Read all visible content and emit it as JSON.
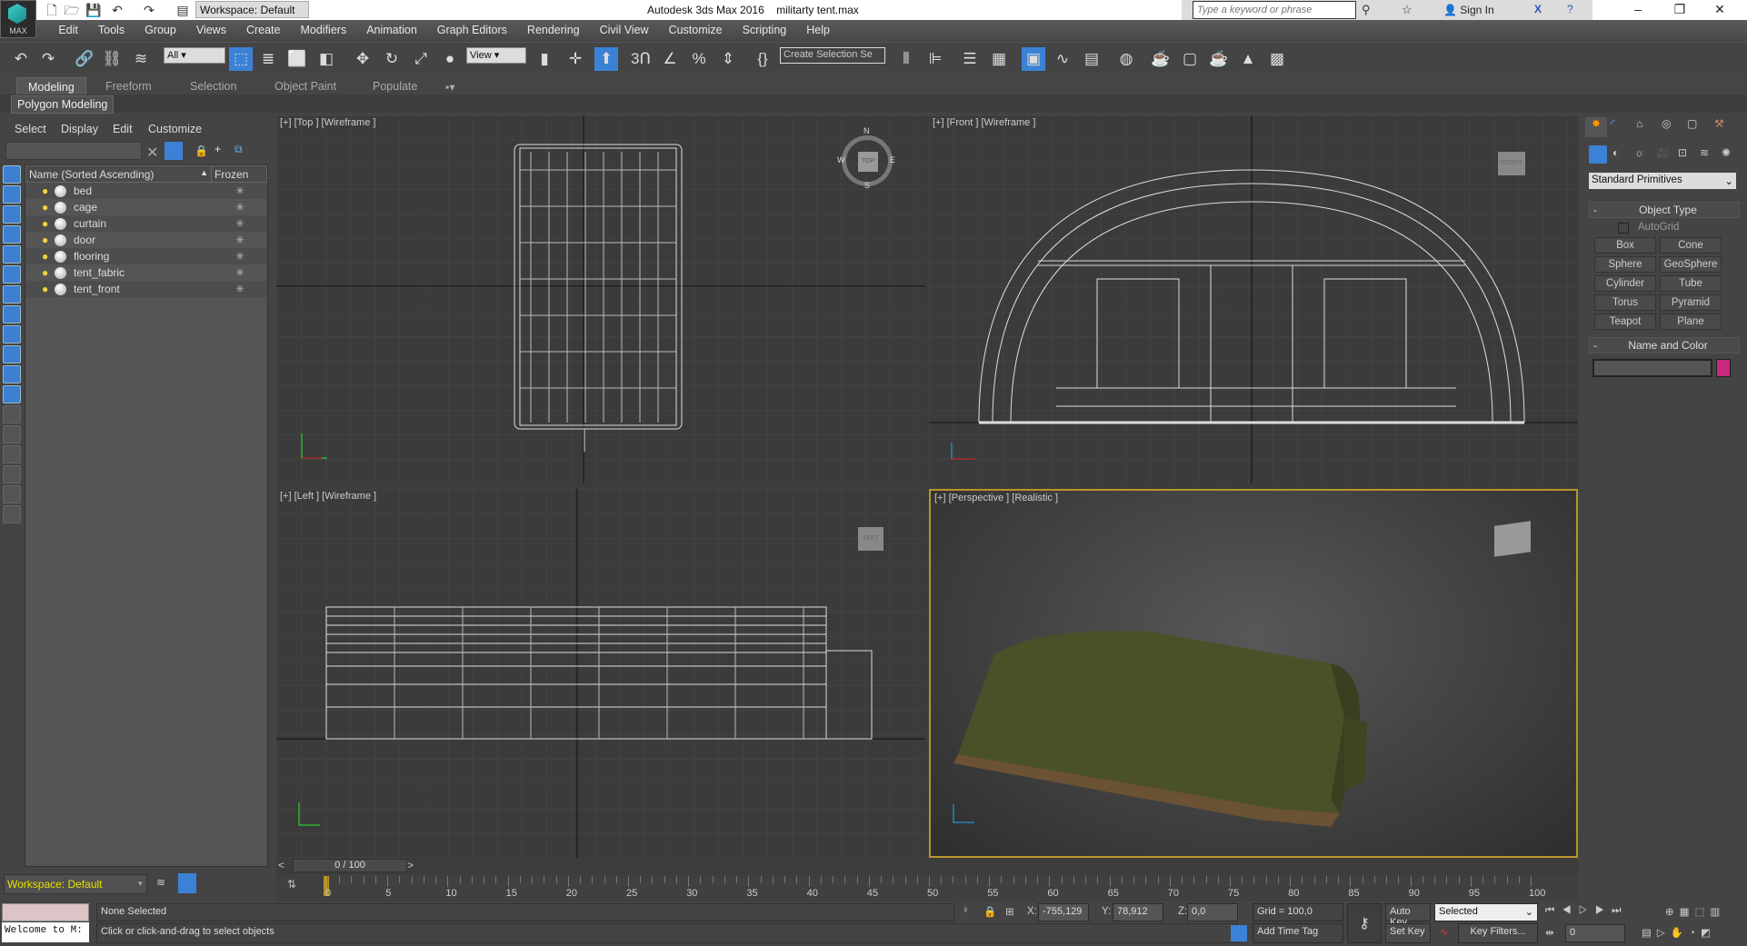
{
  "titlebar": {
    "workspace": "Workspace: Default",
    "app_title": "Autodesk 3ds Max 2016",
    "file_name": "militarty tent.max",
    "search_placeholder": "Type a keyword or phrase",
    "sign_in": "Sign In",
    "logo_text": "MAX"
  },
  "menu": [
    "Edit",
    "Tools",
    "Group",
    "Views",
    "Create",
    "Modifiers",
    "Animation",
    "Graph Editors",
    "Rendering",
    "Civil View",
    "Customize",
    "Scripting",
    "Help"
  ],
  "toolbar": {
    "selection_filter": "All",
    "ref_coord": "View",
    "named_selection": "Create Selection Se"
  },
  "ribbon": {
    "tabs": [
      "Modeling",
      "Freeform",
      "Selection",
      "Object Paint",
      "Populate"
    ],
    "active": "Modeling",
    "panel": "Polygon Modeling"
  },
  "explorer": {
    "menu": [
      "Select",
      "Display",
      "Edit",
      "Customize"
    ],
    "col_name": "Name (Sorted Ascending)",
    "col_frozen": "Frozen",
    "objects": [
      "bed",
      "cage",
      "curtain",
      "door",
      "flooring",
      "tent_fabric",
      "tent_front"
    ],
    "workspace": "Workspace: Default"
  },
  "viewports": {
    "top": "[+] [Top ] [Wireframe ]",
    "front": "[+] [Front ] [Wireframe ]",
    "left": "[+] [Left ] [Wireframe ]",
    "perspective": "[+] [Perspective ] [Realistic ]",
    "cube_top": "TOP",
    "cube_front": "FRONT",
    "cube_left": "LEFT",
    "compass": [
      "N",
      "S",
      "E",
      "W"
    ]
  },
  "command_panel": {
    "category": "Standard Primitives",
    "object_type_title": "Object Type",
    "autogrid": "AutoGrid",
    "primitives": [
      "Box",
      "Cone",
      "Sphere",
      "GeoSphere",
      "Cylinder",
      "Tube",
      "Torus",
      "Pyramid",
      "Teapot",
      "Plane"
    ],
    "name_color_title": "Name and Color",
    "object_color": "#c8287f"
  },
  "timeline": {
    "frame": "0 / 100",
    "ticks": [
      "0",
      "5",
      "10",
      "15",
      "20",
      "25",
      "30",
      "35",
      "40",
      "45",
      "50",
      "55",
      "60",
      "65",
      "70",
      "75",
      "80",
      "85",
      "90",
      "95",
      "100"
    ]
  },
  "status": {
    "selection": "None Selected",
    "prompt": "Click or click-and-drag to select objects",
    "maxscript": "Welcome to M:",
    "x_label": "X:",
    "x": "-755,129",
    "y_label": "Y:",
    "y": "78,912",
    "z_label": "Z:",
    "z": "0,0",
    "grid": "Grid = 100,0",
    "add_time_tag": "Add Time Tag",
    "auto_key": "Auto Key",
    "set_key": "Set Key",
    "key_mode": "Selected",
    "key_filters": "Key Filters...",
    "current_frame": "0"
  }
}
